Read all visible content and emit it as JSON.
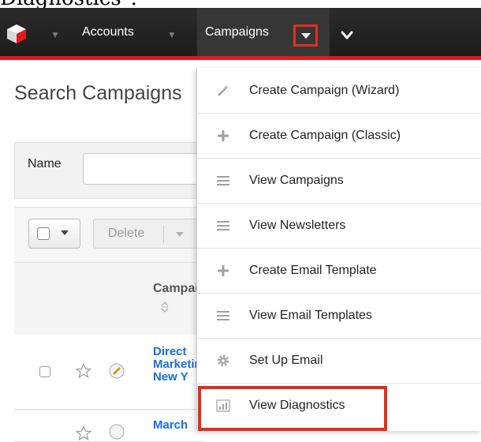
{
  "doc_heading": "Diagnostics\".",
  "nav": {
    "accounts_label": "Accounts",
    "campaigns_label": "Campaigns",
    "logo_icon": "sugar-cube-icon",
    "more_icon": "chevron-down-icon"
  },
  "page": {
    "title": "Search Campaigns",
    "search_label": "Name",
    "delete_label": "Delete",
    "column_header": "Campaign",
    "rows": [
      {
        "lines": [
          "Direct",
          "Marketing",
          "New Y"
        ]
      },
      {
        "lines": [
          "March"
        ]
      }
    ]
  },
  "menu": {
    "items": [
      {
        "label": "Create Campaign (Wizard)",
        "icon": "magic-wand-icon"
      },
      {
        "label": "Create Campaign (Classic)",
        "icon": "plus-icon"
      },
      {
        "label": "View Campaigns",
        "icon": "list-icon"
      },
      {
        "label": "View Newsletters",
        "icon": "list-icon"
      },
      {
        "label": "Create Email Template",
        "icon": "plus-icon"
      },
      {
        "label": "View Email Templates",
        "icon": "list-icon"
      },
      {
        "label": "Set Up Email",
        "icon": "gear-icon"
      },
      {
        "label": "View Diagnostics",
        "icon": "bar-chart-icon"
      }
    ]
  },
  "colors": {
    "nav_bg": "#222222",
    "accent_red": "#e0301e",
    "link_blue": "#176de5"
  }
}
